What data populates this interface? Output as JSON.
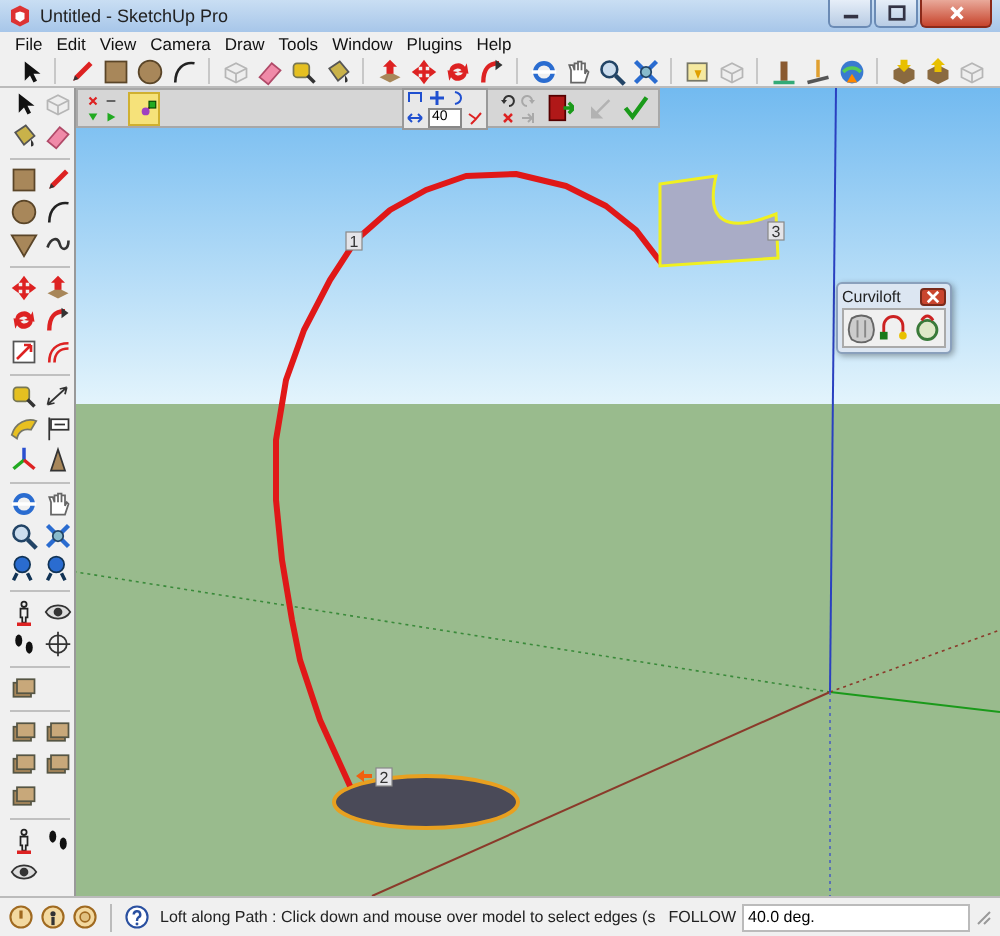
{
  "window": {
    "title": "Untitled - SketchUp Pro"
  },
  "menu": [
    {
      "label": "File"
    },
    {
      "label": "Edit"
    },
    {
      "label": "View"
    },
    {
      "label": "Camera"
    },
    {
      "label": "Draw"
    },
    {
      "label": "Tools"
    },
    {
      "label": "Window"
    },
    {
      "label": "Plugins"
    },
    {
      "label": "Help"
    }
  ],
  "floating_toolbar": {
    "path_tool": {
      "selected": true
    },
    "angle_field": {
      "value": "40"
    }
  },
  "viewport": {
    "vertex_labels": [
      "1",
      "2",
      "3"
    ]
  },
  "curviloft_panel": {
    "title": "Curviloft"
  },
  "status_bar": {
    "message": "Loft along Path : Click down and mouse over model to select edges (s",
    "field_label": "FOLLOW",
    "field_value": "40.0 deg."
  }
}
